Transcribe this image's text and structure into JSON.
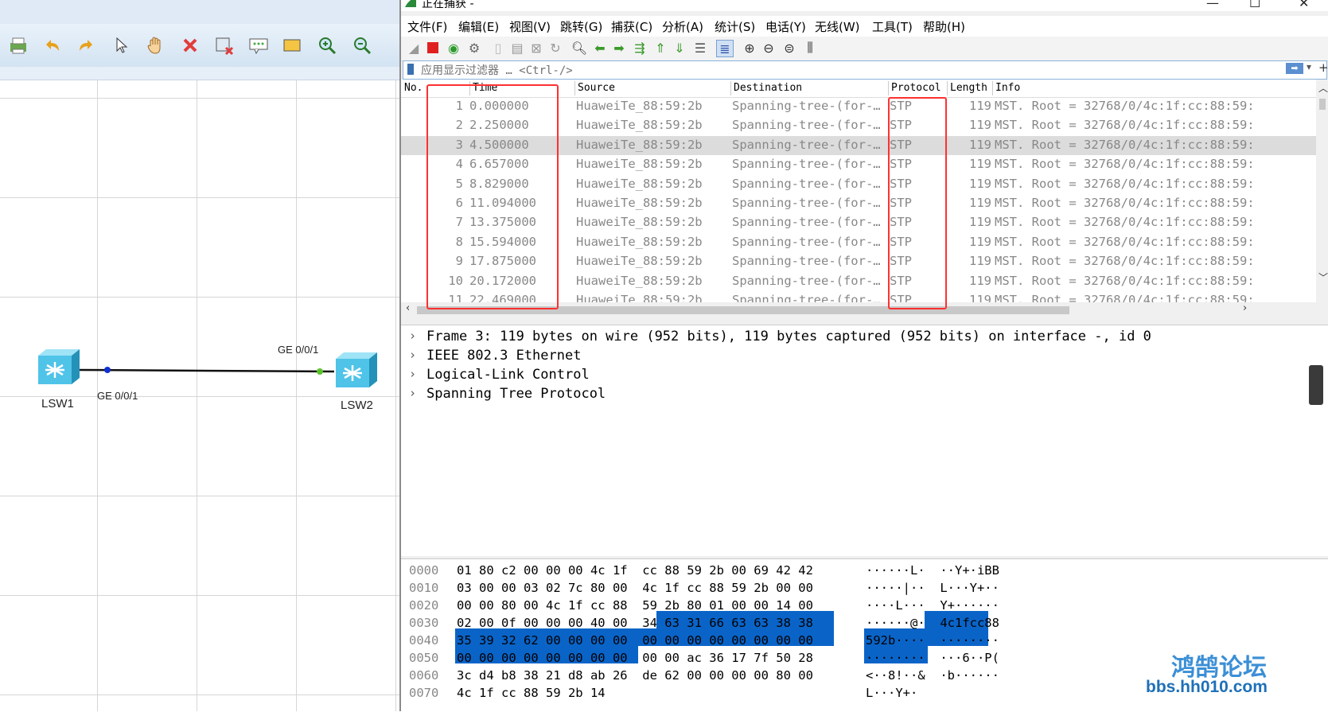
{
  "ensp": {
    "devices": [
      {
        "name": "LSW1"
      },
      {
        "name": "LSW2"
      }
    ],
    "ports": {
      "lsw1": "GE 0/0/1",
      "lsw2": "GE 0/0/1"
    }
  },
  "wireshark": {
    "title": "正在捕获 -",
    "menu": [
      "文件(F)",
      "编辑(E)",
      "视图(V)",
      "跳转(G)",
      "捕获(C)",
      "分析(A)",
      "统计(S)",
      "电话(Y)",
      "无线(W)",
      "工具(T)",
      "帮助(H)"
    ],
    "filter_placeholder": "应用显示过滤器 … <Ctrl-/>",
    "columns": [
      "No.",
      "Time",
      "Source",
      "Destination",
      "Protocol",
      "Length",
      "Info"
    ],
    "packets": [
      {
        "no": "1",
        "time": "0.000000",
        "src": "HuaweiTe_88:59:2b",
        "dst": "Spanning-tree-(for-…",
        "proto": "STP",
        "len": "119",
        "info": "MST. Root = 32768/0/4c:1f:cc:88:59:"
      },
      {
        "no": "2",
        "time": "2.250000",
        "src": "HuaweiTe_88:59:2b",
        "dst": "Spanning-tree-(for-…",
        "proto": "STP",
        "len": "119",
        "info": "MST. Root = 32768/0/4c:1f:cc:88:59:"
      },
      {
        "no": "3",
        "time": "4.500000",
        "src": "HuaweiTe_88:59:2b",
        "dst": "Spanning-tree-(for-…",
        "proto": "STP",
        "len": "119",
        "info": "MST. Root = 32768/0/4c:1f:cc:88:59:"
      },
      {
        "no": "4",
        "time": "6.657000",
        "src": "HuaweiTe_88:59:2b",
        "dst": "Spanning-tree-(for-…",
        "proto": "STP",
        "len": "119",
        "info": "MST. Root = 32768/0/4c:1f:cc:88:59:"
      },
      {
        "no": "5",
        "time": "8.829000",
        "src": "HuaweiTe_88:59:2b",
        "dst": "Spanning-tree-(for-…",
        "proto": "STP",
        "len": "119",
        "info": "MST. Root = 32768/0/4c:1f:cc:88:59:"
      },
      {
        "no": "6",
        "time": "11.094000",
        "src": "HuaweiTe_88:59:2b",
        "dst": "Spanning-tree-(for-…",
        "proto": "STP",
        "len": "119",
        "info": "MST. Root = 32768/0/4c:1f:cc:88:59:"
      },
      {
        "no": "7",
        "time": "13.375000",
        "src": "HuaweiTe_88:59:2b",
        "dst": "Spanning-tree-(for-…",
        "proto": "STP",
        "len": "119",
        "info": "MST. Root = 32768/0/4c:1f:cc:88:59:"
      },
      {
        "no": "8",
        "time": "15.594000",
        "src": "HuaweiTe_88:59:2b",
        "dst": "Spanning-tree-(for-…",
        "proto": "STP",
        "len": "119",
        "info": "MST. Root = 32768/0/4c:1f:cc:88:59:"
      },
      {
        "no": "9",
        "time": "17.875000",
        "src": "HuaweiTe_88:59:2b",
        "dst": "Spanning-tree-(for-…",
        "proto": "STP",
        "len": "119",
        "info": "MST. Root = 32768/0/4c:1f:cc:88:59:"
      },
      {
        "no": "10",
        "time": "20.172000",
        "src": "HuaweiTe_88:59:2b",
        "dst": "Spanning-tree-(for-…",
        "proto": "STP",
        "len": "119",
        "info": "MST. Root = 32768/0/4c:1f:cc:88:59:"
      },
      {
        "no": "11",
        "time": "22.469000",
        "src": "HuaweiTe_88:59:2b",
        "dst": "Spanning-tree-(for-…",
        "proto": "STP",
        "len": "119",
        "info": "MST. Root = 32768/0/4c:1f:cc:88:59:"
      }
    ],
    "selected_row": 3,
    "details": [
      "Frame 3: 119 bytes on wire (952 bits), 119 bytes captured (952 bits) on interface -, id 0",
      "IEEE 802.3 Ethernet",
      "Logical-Link Control",
      "Spanning Tree Protocol"
    ],
    "bytes": [
      {
        "off": "0000",
        "hex": "01 80 c2 00 00 00 4c 1f  cc 88 59 2b 00 69 42 42",
        "asc": "······L·  ··Y+·iBB"
      },
      {
        "off": "0010",
        "hex": "03 00 00 03 02 7c 80 00  4c 1f cc 88 59 2b 00 00",
        "asc": "·····|··  L···Y+··"
      },
      {
        "off": "0020",
        "hex": "00 00 80 00 4c 1f cc 88  59 2b 80 01 00 00 14 00",
        "asc": "····L···  Y+······"
      },
      {
        "off": "0030",
        "hex": "02 00 0f 00 00 00 40 00  34 63 31 66 63 63 38 38",
        "asc": "······@·  4c1fcc88"
      },
      {
        "off": "0040",
        "hex": "35 39 32 62 00 00 00 00  00 00 00 00 00 00 00 00",
        "asc": "592b····  ········"
      },
      {
        "off": "0050",
        "hex": "00 00 00 00 00 00 00 00  00 00 ac 36 17 7f 50 28",
        "asc": "········  ···6··P("
      },
      {
        "off": "0060",
        "hex": "3c d4 b8 38 21 d8 ab 26  de 62 00 00 00 00 80 00",
        "asc": "<··8!··&  ·b······"
      },
      {
        "off": "0070",
        "hex": "4c 1f cc 88 59 2b 14",
        "asc": "L···Y+·"
      }
    ]
  },
  "watermark": {
    "title": "鸿鹄论坛",
    "url": "bbs.hh010.com"
  },
  "colors": {
    "accent": "#0a64c8",
    "highlight_box": "#ff3030",
    "switch": "#4fc3e8"
  }
}
